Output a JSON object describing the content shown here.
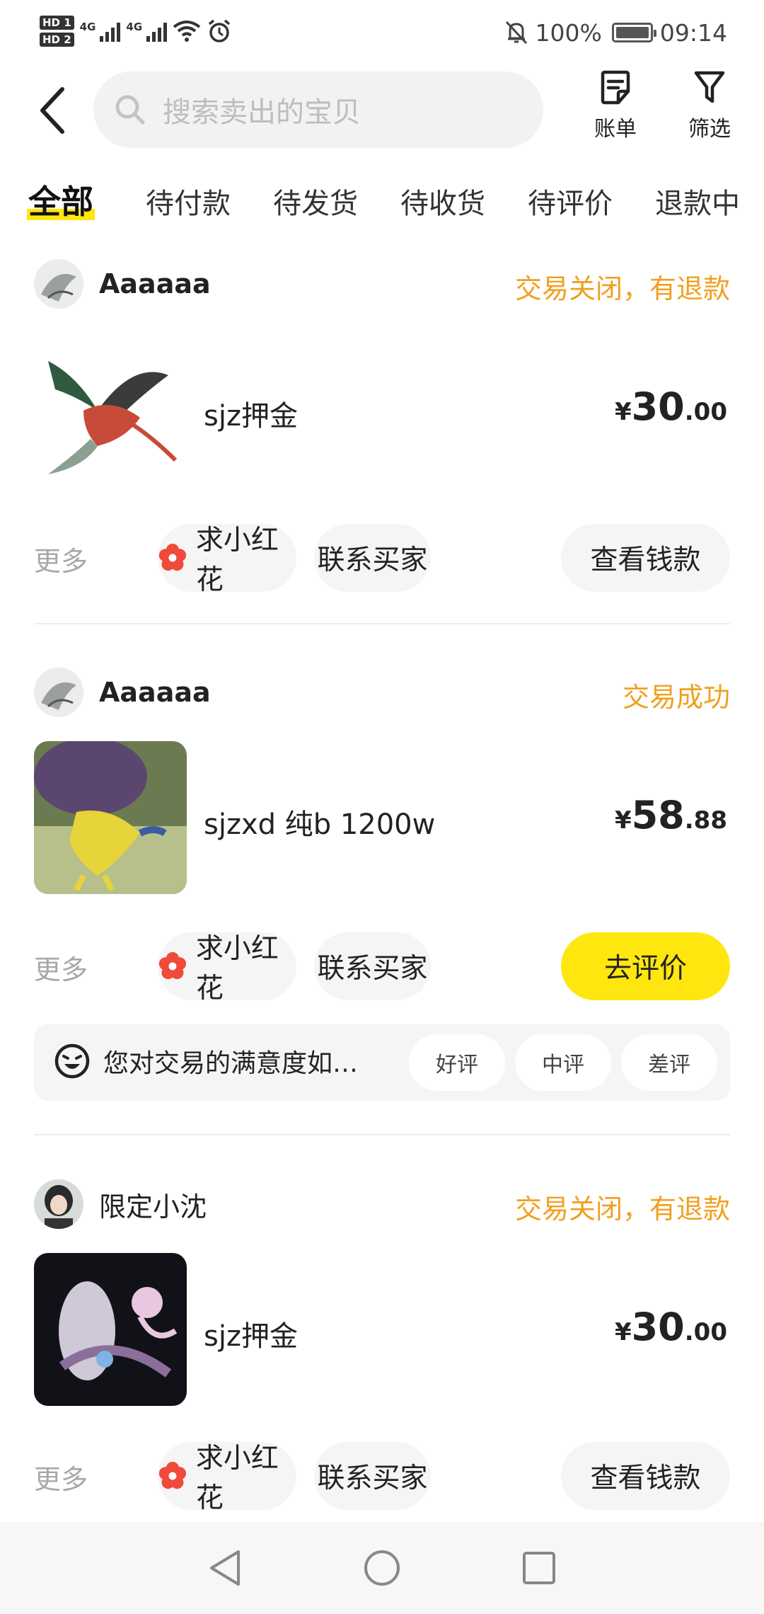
{
  "status_bar": {
    "hd1": "HD 1",
    "hd2": "HD 2",
    "net1": "4G",
    "net2": "4G",
    "battery": "100%",
    "time": "09:14"
  },
  "header": {
    "search_placeholder": "搜索卖出的宝贝",
    "bill_label": "账单",
    "filter_label": "筛选"
  },
  "tabs": [
    {
      "label": "全部",
      "active": true
    },
    {
      "label": "待付款"
    },
    {
      "label": "待发货"
    },
    {
      "label": "待收货"
    },
    {
      "label": "待评价"
    },
    {
      "label": "退款中"
    }
  ],
  "orders": [
    {
      "seller": "Aaaaaa",
      "status": "交易关闭，有退款",
      "title": "sjz押金",
      "price_symbol": "¥",
      "price_int": "30",
      "price_dec": ".00",
      "more": "更多",
      "buttons": [
        "求小红花",
        "联系买家",
        "查看钱款"
      ]
    },
    {
      "seller": "Aaaaaa",
      "status": "交易成功",
      "title": "sjzxd 纯b 1200w",
      "price_symbol": "¥",
      "price_int": "58",
      "price_dec": ".88",
      "more": "更多",
      "buttons": [
        "求小红花",
        "联系买家",
        "去评价"
      ],
      "rating": {
        "question": "您对交易的满意度如…",
        "options": [
          "好评",
          "中评",
          "差评"
        ]
      }
    },
    {
      "seller": "限定小沈",
      "status": "交易关闭，有退款",
      "title": "sjz押金",
      "price_symbol": "¥",
      "price_int": "30",
      "price_dec": ".00",
      "more": "更多",
      "buttons": [
        "求小红花",
        "联系买家",
        "查看钱款"
      ]
    }
  ],
  "colors": {
    "accent_yellow": "#ffe60f",
    "status_orange": "#f0a020",
    "flower_red": "#f04a3a"
  }
}
